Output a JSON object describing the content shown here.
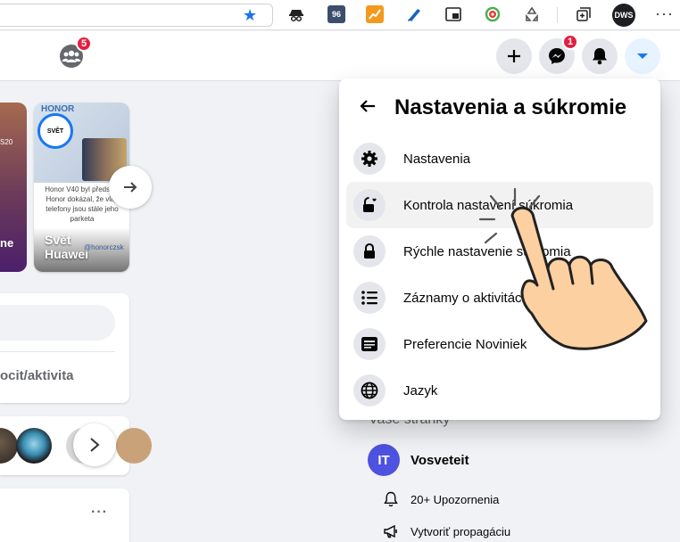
{
  "browser": {
    "ext_badge": "96",
    "profile_label": "DWS",
    "more_label": "···"
  },
  "header": {
    "groups_badge": "5",
    "messenger_badge": "1"
  },
  "stories": {
    "left_name": "ne",
    "left_subtext": "S20",
    "card_avatar_text": "SVĚT",
    "card_brand": "HONOR",
    "card_text": "Honor V40 byl představ Honor dokázal, že vlají telefony jsou stále jeho parketa",
    "card_name": "Svět Huawei",
    "card_handle": "@honorczsk"
  },
  "composer": {
    "action_label": "ocit/aktivita"
  },
  "menu": {
    "title": "Nastavenia a súkromie",
    "items": [
      {
        "label": "Nastavenia",
        "icon": "gear-icon"
      },
      {
        "label": "Kontrola nastavení súkromia",
        "icon": "lock-heart-icon"
      },
      {
        "label": "Rýchle nastavenie súkromia",
        "icon": "lock-icon"
      },
      {
        "label": "Záznamy o aktivitách",
        "icon": "list-icon"
      },
      {
        "label": "Preferencie Noviniek",
        "icon": "news-feed-icon"
      },
      {
        "label": "Jazyk",
        "icon": "globe-icon"
      }
    ]
  },
  "right_column": {
    "pages_heading": "Vaše stránky",
    "page_initials": "IT",
    "page_name": "Vosveteit",
    "notifications": "20+ Upozornenia",
    "promote": "Vytvoriť propagáciu"
  },
  "colors": {
    "fb_blue": "#1877f2",
    "badge_red": "#e41e3f",
    "page_avatar": "#4d52e0",
    "hand_fill": "#fcd0a1"
  }
}
